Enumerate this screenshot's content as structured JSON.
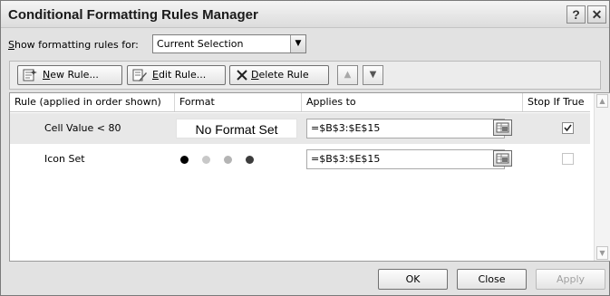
{
  "window": {
    "title": "Conditional Formatting Rules Manager",
    "help_glyph": "?",
    "close_glyph": "✕"
  },
  "show_rules": {
    "label_accel": "S",
    "label_rest": "how formatting rules for:",
    "selected": "Current Selection",
    "dropdown_glyph": "▼"
  },
  "toolbar": {
    "new_rule_accel": "N",
    "new_rule_rest": "ew Rule...",
    "edit_rule_accel": "E",
    "edit_rule_rest": "dit Rule...",
    "delete_rule_accel": "D",
    "delete_rule_rest": "elete Rule",
    "move_up_glyph": "▲",
    "move_down_glyph": "▼"
  },
  "columns": {
    "rule": "Rule (applied in order shown)",
    "format": "Format",
    "applies_to": "Applies to",
    "stop_if_true": "Stop If True"
  },
  "rules": [
    {
      "name": "Cell Value < 80",
      "format_preview": "No Format Set",
      "applies_to": "=$B$3:$E$15",
      "stop_if_true": true
    },
    {
      "name": "Icon Set",
      "icon_colors": [
        "#000000",
        "#c8c8c8",
        "#b4b4b4",
        "#3c3c3c"
      ],
      "applies_to": "=$B$3:$E$15",
      "stop_if_true": false
    }
  ],
  "footer": {
    "ok": "OK",
    "close": "Close",
    "apply": "Apply"
  }
}
